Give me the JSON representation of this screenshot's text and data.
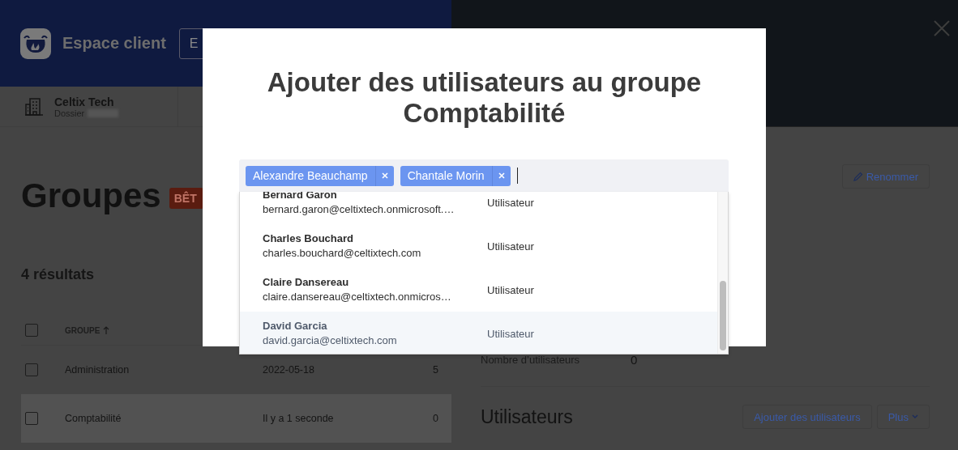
{
  "header": {
    "app_title": "Espace client",
    "button": "E"
  },
  "account": {
    "name": "Celtix Tech",
    "file_label": "Dossier"
  },
  "groups_page": {
    "title": "Groupes",
    "badge": "BÊT",
    "results": "4 résultats"
  },
  "table": {
    "header_checked": false,
    "columns": [
      {
        "label": "GROUPE",
        "sorted_ascending": true
      }
    ],
    "rows": [
      {
        "name": "Administration",
        "date": "2022-05-18",
        "count": "5",
        "checked": false,
        "selected": false
      },
      {
        "name": "Comptabilité",
        "date": "Il y a 1 seconde",
        "count": "0",
        "checked": false,
        "selected": true
      }
    ]
  },
  "detail": {
    "rename_button": "Renommer",
    "field_label": "Nombre d’utilisateurs",
    "field_value": "0",
    "section_title": "Utilisateurs",
    "add_button": "Ajouter des utilisateurs",
    "more_button": "Plus"
  },
  "dialog": {
    "title": "Ajouter des utilisateurs au groupe Comptabilité",
    "chips": [
      {
        "label": "Alexandre Beauchamp"
      },
      {
        "label": "Chantale Morin"
      }
    ],
    "options": [
      {
        "name": "Bernard Garon",
        "email": "bernard.garon@celtixtech.onmicrosoft.…",
        "role": "Utilisateur",
        "highlighted": false
      },
      {
        "name": "Charles Bouchard",
        "email": "charles.bouchard@celtixtech.com",
        "role": "Utilisateur",
        "highlighted": false
      },
      {
        "name": "Claire Dansereau",
        "email": "claire.dansereau@celtixtech.onmicros…",
        "role": "Utilisateur",
        "highlighted": false
      },
      {
        "name": "David Garcia",
        "email": "david.garcia@celtixtech.com",
        "role": "Utilisateur",
        "highlighted": true
      }
    ]
  }
}
